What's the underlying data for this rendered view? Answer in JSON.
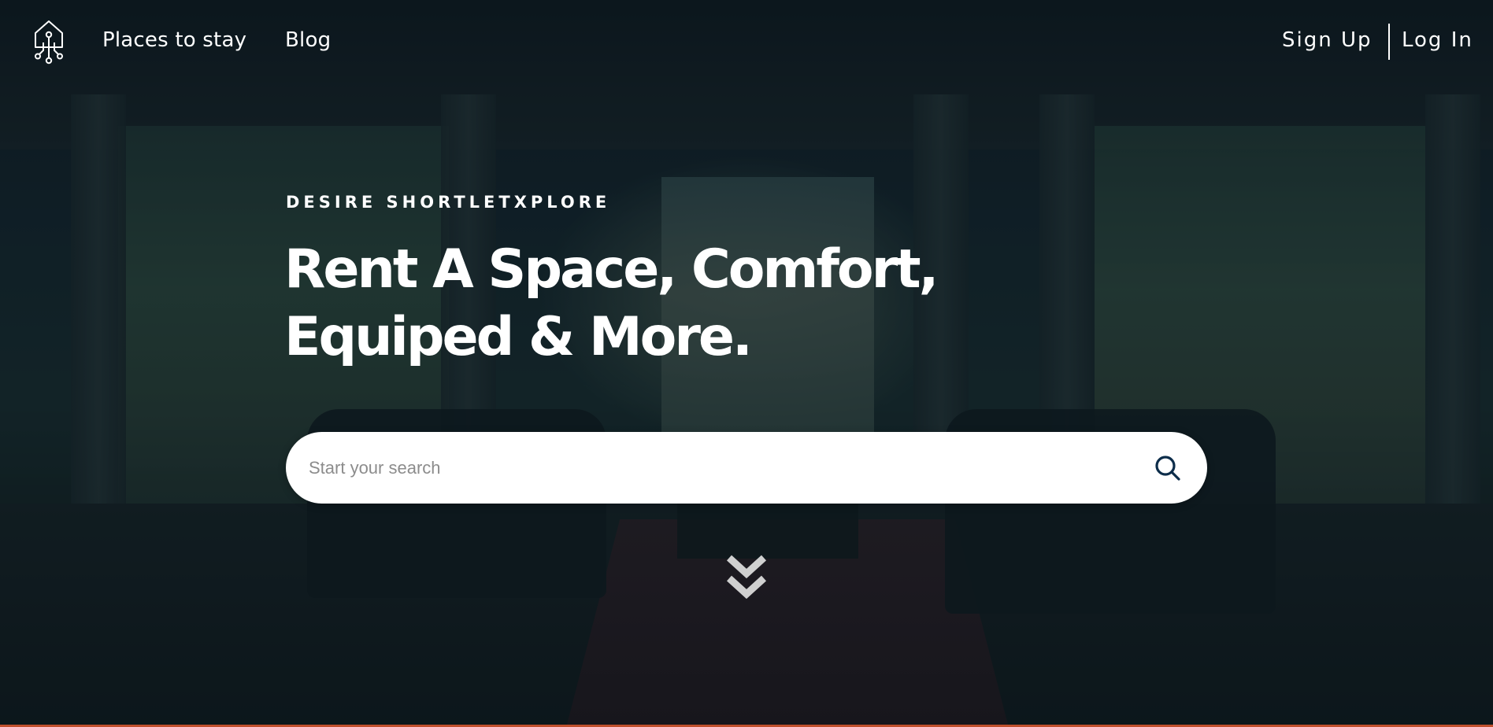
{
  "nav": {
    "logo_icon": "circuit-house-icon",
    "places_label": "Places to stay",
    "blog_label": "Blog",
    "signup_label": "Sign Up",
    "login_label": "Log In"
  },
  "hero": {
    "eyebrow": "DESIRE SHORTLETXPLORE",
    "headline_line1": "Rent A Space, Comfort,",
    "headline_line2": "Equiped & More."
  },
  "search": {
    "placeholder": "Start your search",
    "value": "",
    "button_icon": "search-icon"
  },
  "scroll": {
    "icon": "double-chevron-down-icon"
  },
  "colors": {
    "text": "#ffffff",
    "search_icon": "#0d2d4a",
    "chevron": "#d0d0d0",
    "bottom_accent": "#c0502d"
  }
}
